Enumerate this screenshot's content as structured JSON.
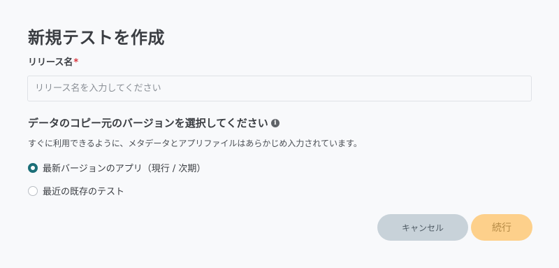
{
  "dialog": {
    "title": "新規テストを作成",
    "release_name": {
      "label": "リリース名",
      "required_mark": "*",
      "placeholder": "リリース名を入力してください",
      "value": ""
    },
    "version_section": {
      "heading": "データのコピー元のバージョンを選択してください",
      "info_icon": "info-icon",
      "description": "すぐに利用できるように、メタデータとアプリファイルはあらかじめ入力されています。",
      "options": [
        {
          "label": "最新バージョンのアプリ（現行 / 次期）",
          "selected": true
        },
        {
          "label": "最近の既存のテスト",
          "selected": false
        }
      ]
    },
    "buttons": {
      "cancel_label": "キャンセル",
      "continue_label": "続行",
      "continue_disabled": true
    },
    "colors": {
      "radio_checked": "#1c6f78",
      "required": "#d9363e",
      "cancel_bg": "#c8d2d9",
      "continue_bg": "#fdd08b"
    }
  }
}
